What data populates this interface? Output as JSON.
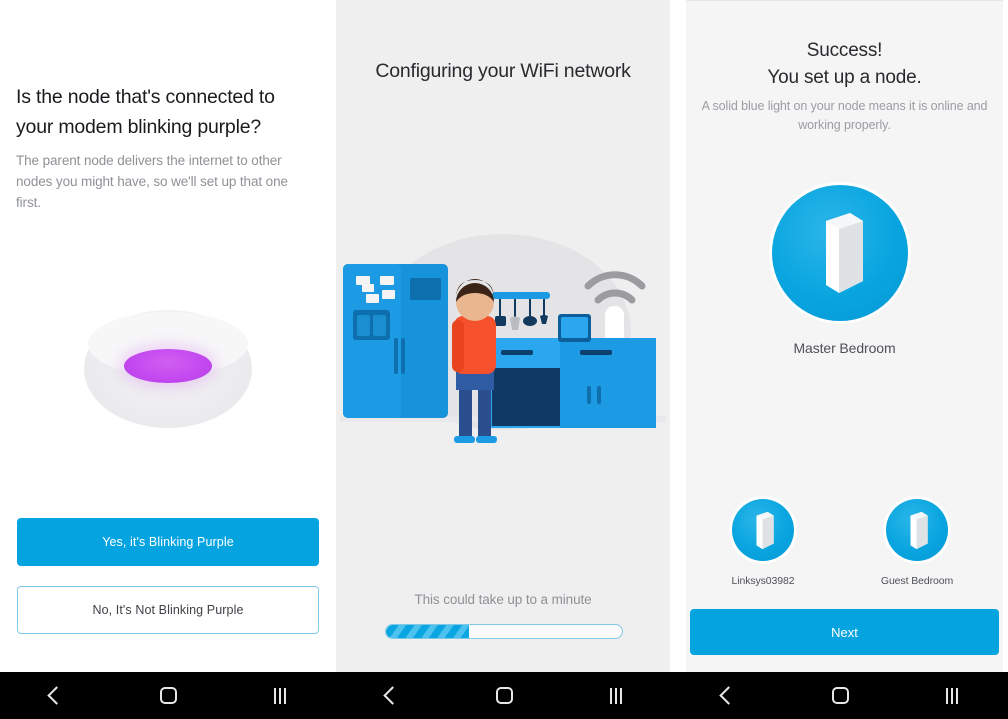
{
  "theme": {
    "accent": "#05a3e0",
    "accent_light": "#4dc2ee",
    "node_light_purple": "#c44af0",
    "panel1_bg": "#ffffff",
    "panel2_bg": "#efeff0",
    "panel3_bg": "#f5f5f6",
    "navbar_bg": "#000000",
    "muted_text": "#8e9196"
  },
  "panel1": {
    "heading": "Is the node that's connected to your modem blinking purple?",
    "subtext": "The parent node delivers the internet to other nodes you might have, so we'll set up that one first.",
    "illustration_name": "node-top-view-purple-light",
    "buttons": {
      "primary_label": "Yes, it's Blinking Purple",
      "secondary_label": "No, It's Not Blinking Purple"
    }
  },
  "panel2": {
    "heading": "Configuring your WiFi network",
    "illustration_name": "kitchen-scene-with-router",
    "note": "This could take up to a minute",
    "progress_percent": 35
  },
  "panel3": {
    "heading_line1": "Success!",
    "heading_line2": "You set up a node.",
    "subtext": "A solid blue light on your node means it is online and working properly.",
    "primary_node_label": "Master Bedroom",
    "other_nodes": [
      {
        "label": "Linksys03982"
      },
      {
        "label": "Guest Bedroom"
      }
    ],
    "next_label": "Next"
  },
  "navbar": {
    "back_icon": "back-chevron-icon",
    "home_icon": "home-square-icon",
    "recents_icon": "recents-bars-icon"
  }
}
